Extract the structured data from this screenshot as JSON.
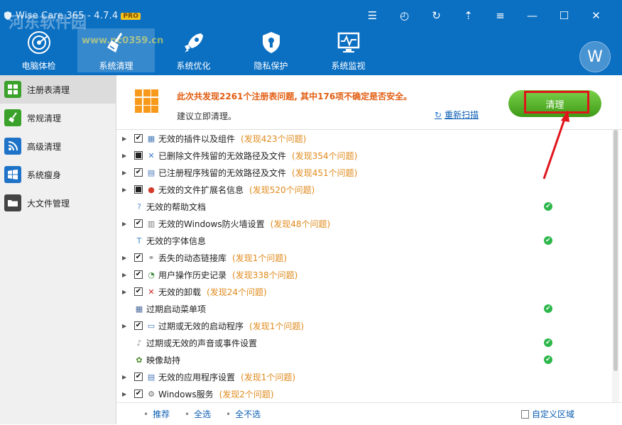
{
  "window": {
    "title": "Wise Care 365 - 4.7.4",
    "pro_badge": "PRO",
    "watermark_text": "河东软件园",
    "watermark_url": "www.pc0359.cn",
    "avatar_letter": "W",
    "accent_color": "#0b6fc2"
  },
  "nav": [
    {
      "label": "电脑体检",
      "icon": "radar-icon"
    },
    {
      "label": "系统清理",
      "icon": "broom-icon"
    },
    {
      "label": "系统优化",
      "icon": "rocket-icon"
    },
    {
      "label": "隐私保护",
      "icon": "shield-icon"
    },
    {
      "label": "系统监视",
      "icon": "monitor-icon"
    }
  ],
  "sidebar": [
    {
      "label": "注册表清理",
      "icon": "registry-icon"
    },
    {
      "label": "常规清理",
      "icon": "broom-icon"
    },
    {
      "label": "高级清理",
      "icon": "advanced-icon"
    },
    {
      "label": "系统瘦身",
      "icon": "windows-icon"
    },
    {
      "label": "大文件管理",
      "icon": "folder-icon"
    }
  ],
  "summary": {
    "main": "此次共发现2261个注册表问题, 其中176项不确定是否安全。",
    "sub": "建议立即清理。",
    "rescan": "重新扫描",
    "clean_button": "清理"
  },
  "items": [
    {
      "label": "无效的插件以及组件",
      "found": "(发现423个问题)",
      "checkbox": "checked",
      "expandable": true
    },
    {
      "label": "已删除文件残留的无效路径及文件",
      "found": "(发现354个问题)",
      "checkbox": "partial",
      "expandable": true
    },
    {
      "label": "已注册程序残留的无效路径及文件",
      "found": "(发现451个问题)",
      "checkbox": "checked",
      "expandable": true
    },
    {
      "label": "无效的文件扩展名信息",
      "found": "(发现520个问题)",
      "checkbox": "partial",
      "expandable": true
    },
    {
      "label": "无效的帮助文档",
      "found": "",
      "checkbox": "none",
      "expandable": false,
      "ok": true
    },
    {
      "label": "无效的Windows防火墙设置",
      "found": "(发现48个问题)",
      "checkbox": "checked",
      "expandable": true
    },
    {
      "label": "无效的字体信息",
      "found": "",
      "checkbox": "none",
      "expandable": false,
      "ok": true
    },
    {
      "label": "丢失的动态链接库",
      "found": "(发现1个问题)",
      "checkbox": "checked",
      "expandable": true
    },
    {
      "label": "用户操作历史记录",
      "found": "(发现338个问题)",
      "checkbox": "checked",
      "expandable": true
    },
    {
      "label": "无效的卸载",
      "found": "(发现24个问题)",
      "checkbox": "checked",
      "expandable": true
    },
    {
      "label": "过期启动菜单项",
      "found": "",
      "checkbox": "none",
      "expandable": false,
      "ok": true
    },
    {
      "label": "过期或无效的启动程序",
      "found": "(发现1个问题)",
      "checkbox": "checked",
      "expandable": true
    },
    {
      "label": "过期或无效的声音或事件设置",
      "found": "",
      "checkbox": "none",
      "expandable": false,
      "ok": true
    },
    {
      "label": "映像劫持",
      "found": "",
      "checkbox": "none",
      "expandable": false,
      "ok": true
    },
    {
      "label": "无效的应用程序设置",
      "found": "(发现1个问题)",
      "checkbox": "checked",
      "expandable": true
    },
    {
      "label": "Windows服务",
      "found": "(发现2个问题)",
      "checkbox": "checked",
      "expandable": true
    }
  ],
  "footer": {
    "recommend": "推荐",
    "select_all": "全选",
    "select_none": "全不选",
    "custom_area": "自定义区域"
  }
}
